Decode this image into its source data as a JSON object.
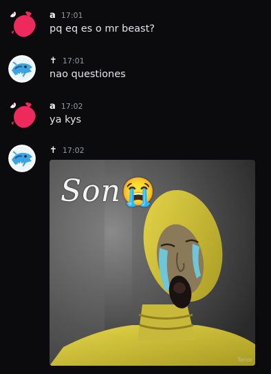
{
  "messages": [
    {
      "author": "a",
      "time": "17:01",
      "text": "pq eq es o mr beast?",
      "avatar": "pink-skull-avatar"
    },
    {
      "author": "✝",
      "time": "17:01",
      "text": "nao questiones",
      "avatar": "mrbeast-panther-avatar"
    },
    {
      "author": "a",
      "time": "17:02",
      "text": "ya kys",
      "avatar": "pink-skull-avatar"
    },
    {
      "author": "✝",
      "time": "17:02",
      "text": "",
      "avatar": "mrbeast-panther-avatar"
    }
  ],
  "attachment": {
    "caption": "Son",
    "emoji": "😭",
    "watermark": "Tenor",
    "description": "meme image"
  },
  "colors": {
    "background": "#0b0b0d",
    "pink_avatar": "#ee2a5d",
    "mrbeast_blue": "#3da3e0"
  }
}
